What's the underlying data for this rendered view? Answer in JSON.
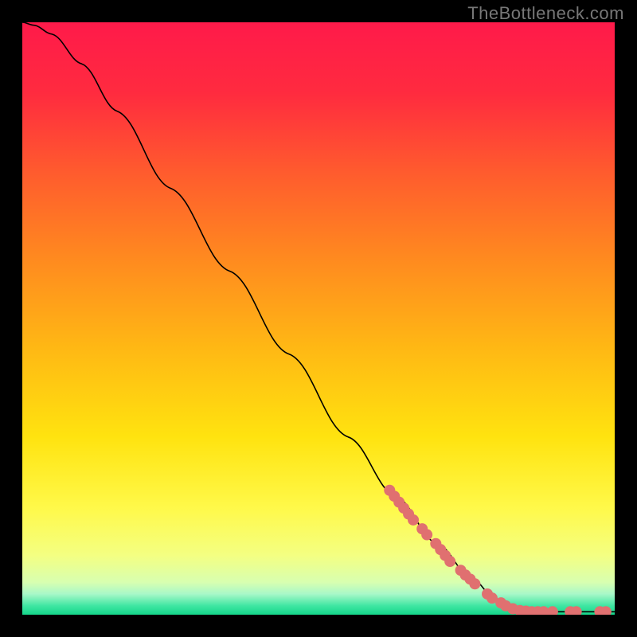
{
  "watermark": "TheBottleneck.com",
  "chart_data": {
    "type": "line",
    "title": "",
    "xlabel": "",
    "ylabel": "",
    "xlim": [
      0,
      100
    ],
    "ylim": [
      0,
      100
    ],
    "background_gradient": {
      "stops": [
        {
          "offset": 0.0,
          "color": "#ff1a4a"
        },
        {
          "offset": 0.12,
          "color": "#ff2b3f"
        },
        {
          "offset": 0.25,
          "color": "#ff5a2e"
        },
        {
          "offset": 0.4,
          "color": "#ff8a1f"
        },
        {
          "offset": 0.55,
          "color": "#ffb814"
        },
        {
          "offset": 0.7,
          "color": "#ffe30f"
        },
        {
          "offset": 0.82,
          "color": "#fff94a"
        },
        {
          "offset": 0.9,
          "color": "#f4ff82"
        },
        {
          "offset": 0.945,
          "color": "#d8ffb0"
        },
        {
          "offset": 0.965,
          "color": "#a8f8c8"
        },
        {
          "offset": 0.985,
          "color": "#3fe6a2"
        },
        {
          "offset": 1.0,
          "color": "#15d68a"
        }
      ]
    },
    "series": [
      {
        "name": "curve",
        "type": "line",
        "color": "#000000",
        "points": [
          {
            "x": 0.0,
            "y": 100.0
          },
          {
            "x": 2.0,
            "y": 99.5
          },
          {
            "x": 5.0,
            "y": 98.0
          },
          {
            "x": 10.0,
            "y": 93.0
          },
          {
            "x": 16.0,
            "y": 85.0
          },
          {
            "x": 25.0,
            "y": 72.0
          },
          {
            "x": 35.0,
            "y": 58.0
          },
          {
            "x": 45.0,
            "y": 44.0
          },
          {
            "x": 55.0,
            "y": 30.0
          },
          {
            "x": 63.0,
            "y": 20.0
          },
          {
            "x": 70.0,
            "y": 12.0
          },
          {
            "x": 76.0,
            "y": 6.0
          },
          {
            "x": 80.0,
            "y": 2.5
          },
          {
            "x": 83.0,
            "y": 1.0
          },
          {
            "x": 86.0,
            "y": 0.5
          },
          {
            "x": 100.0,
            "y": 0.5
          }
        ]
      },
      {
        "name": "markers",
        "type": "scatter",
        "color": "#e07070",
        "radius": 7,
        "points": [
          {
            "x": 62.0,
            "y": 21.0
          },
          {
            "x": 62.8,
            "y": 20.0
          },
          {
            "x": 63.6,
            "y": 19.0
          },
          {
            "x": 64.4,
            "y": 18.0
          },
          {
            "x": 65.2,
            "y": 17.0
          },
          {
            "x": 66.0,
            "y": 16.0
          },
          {
            "x": 67.5,
            "y": 14.5
          },
          {
            "x": 68.3,
            "y": 13.5
          },
          {
            "x": 69.8,
            "y": 12.0
          },
          {
            "x": 70.6,
            "y": 11.0
          },
          {
            "x": 71.4,
            "y": 10.0
          },
          {
            "x": 72.2,
            "y": 9.0
          },
          {
            "x": 74.0,
            "y": 7.5
          },
          {
            "x": 74.8,
            "y": 6.7
          },
          {
            "x": 75.6,
            "y": 6.0
          },
          {
            "x": 76.4,
            "y": 5.2
          },
          {
            "x": 78.5,
            "y": 3.5
          },
          {
            "x": 79.3,
            "y": 2.8
          },
          {
            "x": 80.8,
            "y": 2.0
          },
          {
            "x": 81.6,
            "y": 1.5
          },
          {
            "x": 82.8,
            "y": 1.0
          },
          {
            "x": 84.0,
            "y": 0.7
          },
          {
            "x": 85.0,
            "y": 0.6
          },
          {
            "x": 86.0,
            "y": 0.5
          },
          {
            "x": 87.0,
            "y": 0.5
          },
          {
            "x": 88.0,
            "y": 0.5
          },
          {
            "x": 89.5,
            "y": 0.5
          },
          {
            "x": 92.5,
            "y": 0.5
          },
          {
            "x": 93.5,
            "y": 0.5
          },
          {
            "x": 97.5,
            "y": 0.5
          },
          {
            "x": 98.5,
            "y": 0.5
          }
        ]
      }
    ]
  }
}
